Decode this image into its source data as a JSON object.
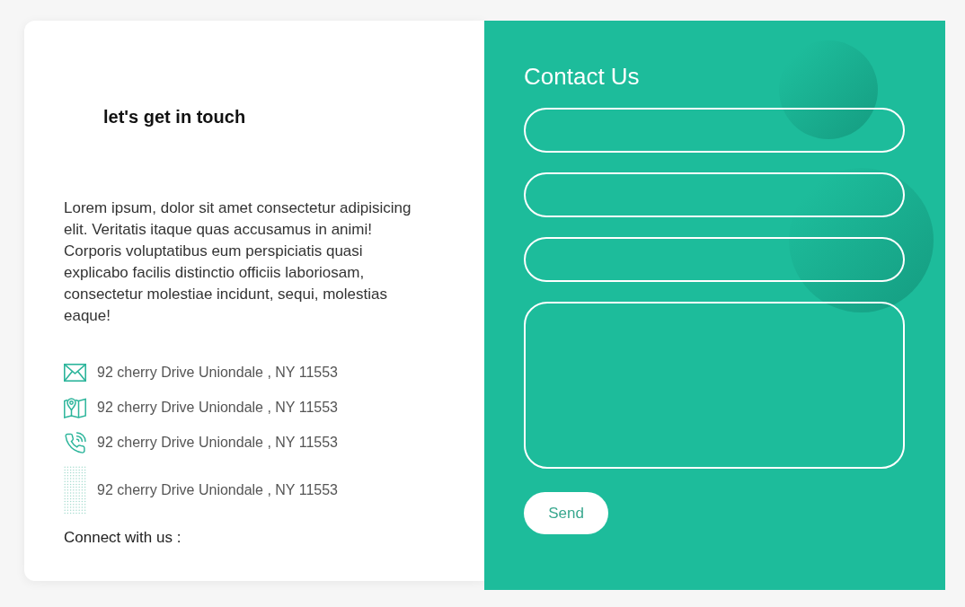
{
  "info": {
    "heading": "let's get in touch",
    "text": "Lorem ipsum, dolor sit amet consectetur adipisicing elit. Veritatis itaque quas accusamus in animi! Corporis voluptatibus eum perspiciatis quasi explicabo facilis distinctio officiis laboriosam, consectetur molestiae incidunt, sequi, molestias eaque!",
    "items": [
      {
        "kind": "email",
        "text": "92 cherry Drive Uniondale , NY 11553"
      },
      {
        "kind": "map",
        "text": "92 cherry Drive Uniondale , NY 11553"
      },
      {
        "kind": "phone",
        "text": "92 cherry Drive Uniondale , NY 11553"
      },
      {
        "kind": "dots",
        "text": "92 cherry Drive Uniondale , NY 11553"
      }
    ],
    "connect_label": "Connect with us :"
  },
  "contact": {
    "title": "Contact Us",
    "fields": [
      {
        "kind": "input"
      },
      {
        "kind": "input"
      },
      {
        "kind": "input"
      },
      {
        "kind": "textarea"
      }
    ],
    "button": "Send"
  }
}
